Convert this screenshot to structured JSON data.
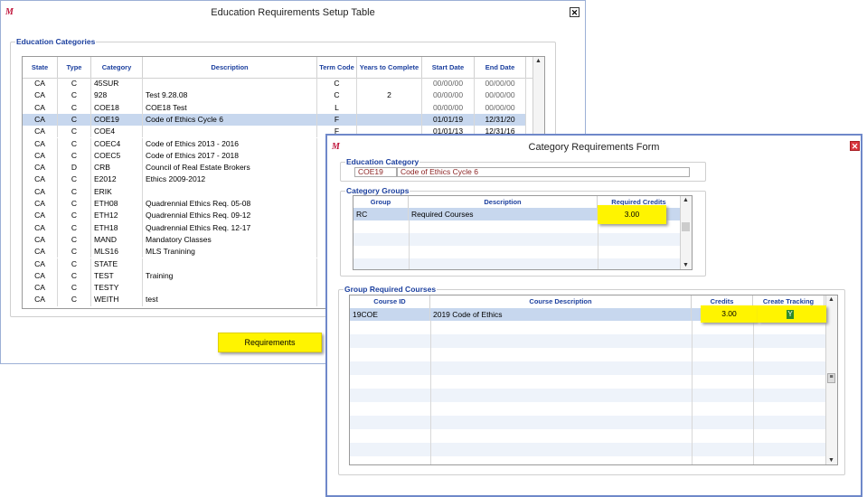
{
  "main_window": {
    "title": "Education Requirements Setup Table",
    "group_label": "Education Categories",
    "columns": [
      "State",
      "Type",
      "Category",
      "Description",
      "Term Code",
      "Years to Complete",
      "Start Date",
      "End Date"
    ],
    "rows": [
      [
        "CA",
        "C",
        "45SUR",
        "",
        "C",
        "",
        "00/00/00",
        "00/00/00"
      ],
      [
        "CA",
        "C",
        "928",
        "Test 9.28.08",
        "C",
        "2",
        "00/00/00",
        "00/00/00"
      ],
      [
        "CA",
        "C",
        "COE18",
        "COE18 Test",
        "L",
        "",
        "00/00/00",
        "00/00/00"
      ],
      [
        "CA",
        "C",
        "COE19",
        "Code of Ethics Cycle 6",
        "F",
        "",
        "01/01/19",
        "12/31/20"
      ],
      [
        "CA",
        "C",
        "COE4",
        "",
        "F",
        "",
        "01/01/13",
        "12/31/16"
      ],
      [
        "CA",
        "C",
        "COEC4",
        "Code of Ethics 2013 - 2016",
        "",
        "",
        "",
        ""
      ],
      [
        "CA",
        "C",
        "COEC5",
        "Code of Ethics 2017 - 2018",
        "",
        "",
        "",
        ""
      ],
      [
        "CA",
        "D",
        "CRB",
        "Council of Real Estate Brokers",
        "",
        "",
        "",
        ""
      ],
      [
        "CA",
        "C",
        "E2012",
        "Ethics 2009-2012",
        "",
        "",
        "",
        ""
      ],
      [
        "CA",
        "C",
        "ERIK",
        "",
        "",
        "",
        "",
        ""
      ],
      [
        "CA",
        "C",
        "ETH08",
        "Quadrennial Ethics Req. 05-08",
        "",
        "",
        "",
        ""
      ],
      [
        "CA",
        "C",
        "ETH12",
        "Quadrennial Ethics Req. 09-12",
        "",
        "",
        "",
        ""
      ],
      [
        "CA",
        "C",
        "ETH18",
        "Quadrennial Ethics Req. 12-17",
        "",
        "",
        "",
        ""
      ],
      [
        "CA",
        "C",
        "MAND",
        "Mandatory Classes",
        "",
        "",
        "",
        ""
      ],
      [
        "CA",
        "C",
        "MLS16",
        "MLS Tranining",
        "",
        "",
        "",
        ""
      ],
      [
        "CA",
        "C",
        "STATE",
        "",
        "",
        "",
        "",
        ""
      ],
      [
        "CA",
        "C",
        "TEST",
        "Training",
        "",
        "",
        "",
        ""
      ],
      [
        "CA",
        "C",
        "TESTY",
        "",
        "",
        "",
        "",
        ""
      ],
      [
        "CA",
        "C",
        "WEITH",
        "test",
        "",
        "",
        "",
        ""
      ]
    ],
    "selected_row": 3,
    "requirements_button": "Requirements"
  },
  "form": {
    "title": "Category Requirements Form",
    "edu_category_label": "Education Category",
    "category_code": "COE19",
    "category_desc": "Code of Ethics Cycle 6",
    "category_groups_label": "Category Groups",
    "group_columns": [
      "Group",
      "Description",
      "Required Credits"
    ],
    "group_row": {
      "group": "RC",
      "description": "Required Courses",
      "credits": "3.00"
    },
    "courses_label": "Group Required Courses",
    "course_columns": [
      "Course ID",
      "Course Description",
      "Credits",
      "Create Tracking"
    ],
    "course_row": {
      "course_id": "19COE",
      "description": "2019 Code of Ethics",
      "credits": "3.00",
      "tracking": "Y"
    }
  },
  "colors": {
    "highlight": "#fff400",
    "label_blue": "#1b3f9e",
    "selected_row": "#c7d7ee",
    "accent_red": "#c0163c"
  }
}
